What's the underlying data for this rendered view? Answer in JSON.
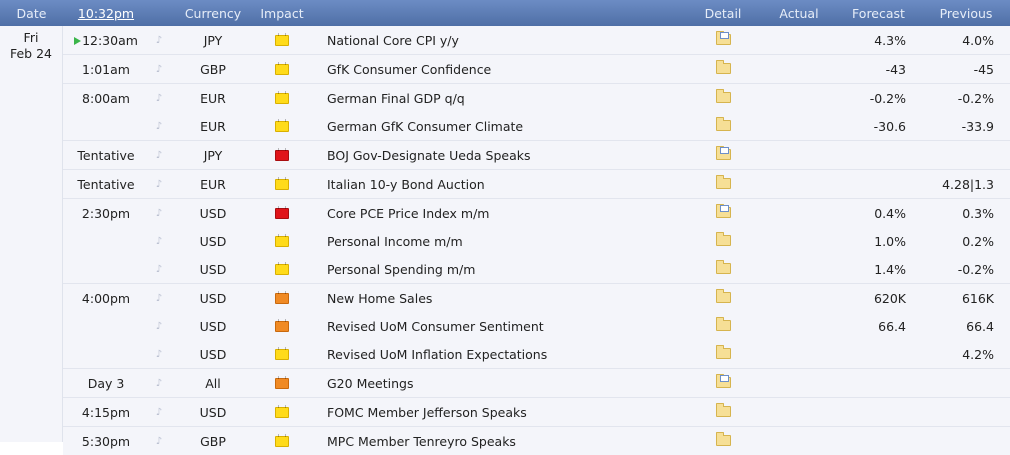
{
  "header": {
    "date": "Date",
    "clock": "10:32pm",
    "currency": "Currency",
    "impact": "Impact",
    "detail": "Detail",
    "actual": "Actual",
    "forecast": "Forecast",
    "previous": "Previous"
  },
  "date_cell": {
    "day": "Fri",
    "date": "Feb 24"
  },
  "colors": {
    "header": "#5b7ab3",
    "row_bg": "#f4f5fa",
    "low": "#ffdb1a",
    "medium": "#f08a24",
    "high": "#e0141a"
  },
  "events": [
    {
      "time": "12:30am",
      "currency": "JPY",
      "impact": "low",
      "event": "National Core CPI y/y",
      "detail_icon": "detail-folder-doc-icon",
      "actual": "",
      "forecast": "4.3%",
      "previous": "4.0%"
    },
    {
      "time": "1:01am",
      "currency": "GBP",
      "impact": "low",
      "event": "GfK Consumer Confidence",
      "detail_icon": "detail-folder-icon",
      "actual": "",
      "forecast": "-43",
      "previous": "-45"
    },
    {
      "time": "8:00am",
      "currency": "EUR",
      "impact": "low",
      "event": "German Final GDP q/q",
      "detail_icon": "detail-folder-icon",
      "actual": "",
      "forecast": "-0.2%",
      "previous": "-0.2%"
    },
    {
      "time": "",
      "currency": "EUR",
      "impact": "low",
      "event": "German GfK Consumer Climate",
      "detail_icon": "detail-folder-icon",
      "actual": "",
      "forecast": "-30.6",
      "previous": "-33.9"
    },
    {
      "time": "Tentative",
      "currency": "JPY",
      "impact": "high",
      "event": "BOJ Gov-Designate Ueda Speaks",
      "detail_icon": "detail-folder-doc-icon",
      "actual": "",
      "forecast": "",
      "previous": ""
    },
    {
      "time": "Tentative",
      "currency": "EUR",
      "impact": "low",
      "event": "Italian 10-y Bond Auction",
      "detail_icon": "detail-folder-icon",
      "actual": "",
      "forecast": "",
      "previous": "4.28|1.3"
    },
    {
      "time": "2:30pm",
      "currency": "USD",
      "impact": "high",
      "event": "Core PCE Price Index m/m",
      "detail_icon": "detail-folder-doc-icon",
      "actual": "",
      "forecast": "0.4%",
      "previous": "0.3%"
    },
    {
      "time": "",
      "currency": "USD",
      "impact": "low",
      "event": "Personal Income m/m",
      "detail_icon": "detail-folder-icon",
      "actual": "",
      "forecast": "1.0%",
      "previous": "0.2%"
    },
    {
      "time": "",
      "currency": "USD",
      "impact": "low",
      "event": "Personal Spending m/m",
      "detail_icon": "detail-folder-icon",
      "actual": "",
      "forecast": "1.4%",
      "previous": "-0.2%"
    },
    {
      "time": "4:00pm",
      "currency": "USD",
      "impact": "medium",
      "event": "New Home Sales",
      "detail_icon": "detail-folder-icon",
      "actual": "",
      "forecast": "620K",
      "previous": "616K"
    },
    {
      "time": "",
      "currency": "USD",
      "impact": "medium",
      "event": "Revised UoM Consumer Sentiment",
      "detail_icon": "detail-folder-icon",
      "actual": "",
      "forecast": "66.4",
      "previous": "66.4"
    },
    {
      "time": "",
      "currency": "USD",
      "impact": "low",
      "event": "Revised UoM Inflation Expectations",
      "detail_icon": "detail-folder-icon",
      "actual": "",
      "forecast": "",
      "previous": "4.2%"
    },
    {
      "time": "Day 3",
      "currency": "All",
      "impact": "medium",
      "event": "G20 Meetings",
      "detail_icon": "detail-folder-doc-icon",
      "actual": "",
      "forecast": "",
      "previous": ""
    },
    {
      "time": "4:15pm",
      "currency": "USD",
      "impact": "low",
      "event": "FOMC Member Jefferson Speaks",
      "detail_icon": "detail-folder-icon",
      "actual": "",
      "forecast": "",
      "previous": ""
    },
    {
      "time": "5:30pm",
      "currency": "GBP",
      "impact": "low",
      "event": "MPC Member Tenreyro Speaks",
      "detail_icon": "detail-folder-icon",
      "actual": "",
      "forecast": "",
      "previous": ""
    }
  ]
}
